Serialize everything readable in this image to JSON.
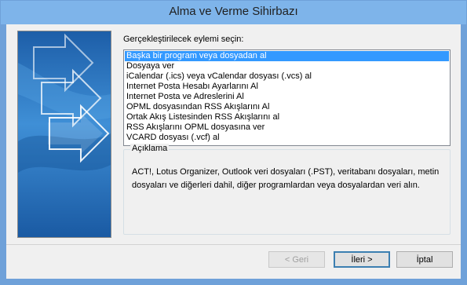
{
  "window": {
    "title": "Alma ve Verme Sihirbazı"
  },
  "prompt": "Gerçekleştirilecek eylemi seçin:",
  "actions": [
    "Başka bir program veya dosyadan al",
    "Dosyaya ver",
    "iCalendar (.ics) veya vCalendar dosyası (.vcs) al",
    "Internet Posta Hesabı Ayarlarını Al",
    "Internet Posta ve Adreslerini Al",
    "OPML dosyasından RSS Akışlarını Al",
    "Ortak Akış Listesinden RSS Akışlarını al",
    "RSS Akışlarını OPML dosyasına ver",
    "VCARD dosyası (.vcf) al"
  ],
  "selected_index": 0,
  "description": {
    "label": "Açıklama",
    "text": "ACT!, Lotus Organizer, Outlook veri dosyaları (.PST), veritabanı dosyaları, metin dosyaları ve diğerleri dahil, diğer programlardan veya dosyalardan veri alın."
  },
  "buttons": {
    "back": "< Geri",
    "next": "İleri >",
    "cancel": "İptal"
  }
}
